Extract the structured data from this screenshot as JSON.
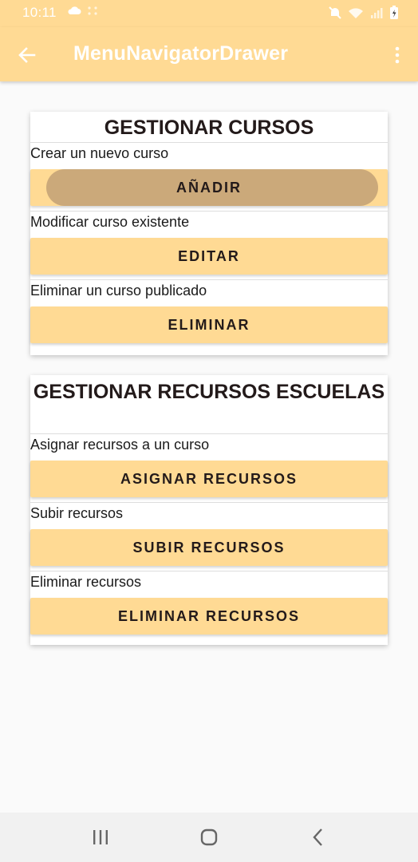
{
  "status": {
    "time": "10:11"
  },
  "appbar": {
    "title": "MenuNavigatorDrawer"
  },
  "cursos": {
    "title": "GESTIONAR CURSOS",
    "sections": [
      {
        "label": "Crear un nuevo curso",
        "button": "AÑADIR"
      },
      {
        "label": "Modificar curso existente",
        "button": "EDITAR"
      },
      {
        "label": "Eliminar un curso publicado",
        "button": "ELIMINAR"
      }
    ]
  },
  "recursos": {
    "title": "GESTIONAR RECURSOS ESCUELAS",
    "sections": [
      {
        "label": "Asignar recursos a un curso",
        "button": "ASIGNAR RECURSOS"
      },
      {
        "label": "Subir recursos",
        "button": "SUBIR RECURSOS"
      },
      {
        "label": "Eliminar recursos",
        "button": "ELIMINAR RECURSOS"
      }
    ]
  },
  "colors": {
    "accent": "#ffda94",
    "pressed": "#cba97a",
    "text": "#231a1a"
  },
  "icons": {
    "back": "arrow-back-icon",
    "menu": "more-vert-icon",
    "recents": "recents-icon",
    "home": "home-icon",
    "nav_back": "nav-back-icon"
  }
}
